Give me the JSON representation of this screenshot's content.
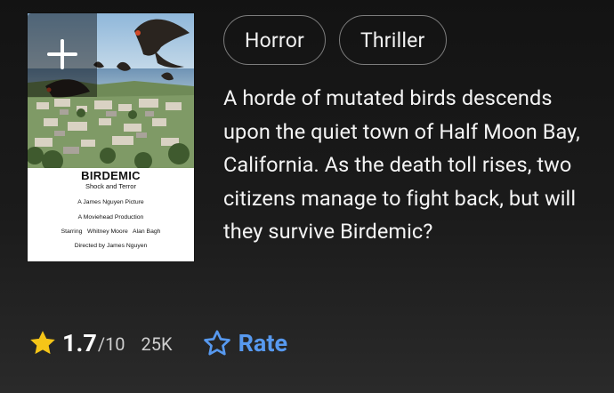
{
  "poster": {
    "title": "BIRDEMIC",
    "tagline": "Shock and Terror",
    "credit_picture": "A James Nguyen Picture",
    "credit_production": "A Moviehead Production",
    "credit_starring": "Starring   Whitney Moore   Alan Bagh",
    "credit_director": "Directed by James Nguyen",
    "add_icon": "plus-icon"
  },
  "genres": [
    {
      "label": "Horror"
    },
    {
      "label": "Thriller"
    }
  ],
  "description": "A horde of mutated birds descends upon the quiet town of Half Moon Bay, California. As the death toll rises, two citizens manage to fight back, but will they survive Birdemic?",
  "rating": {
    "value": "1.7",
    "max": "/10",
    "count": "25K",
    "star_icon": "star-filled-icon",
    "star_color": "#f5c518"
  },
  "rate_button": {
    "label": "Rate",
    "icon": "star-outline-icon",
    "color": "#5799ef"
  }
}
